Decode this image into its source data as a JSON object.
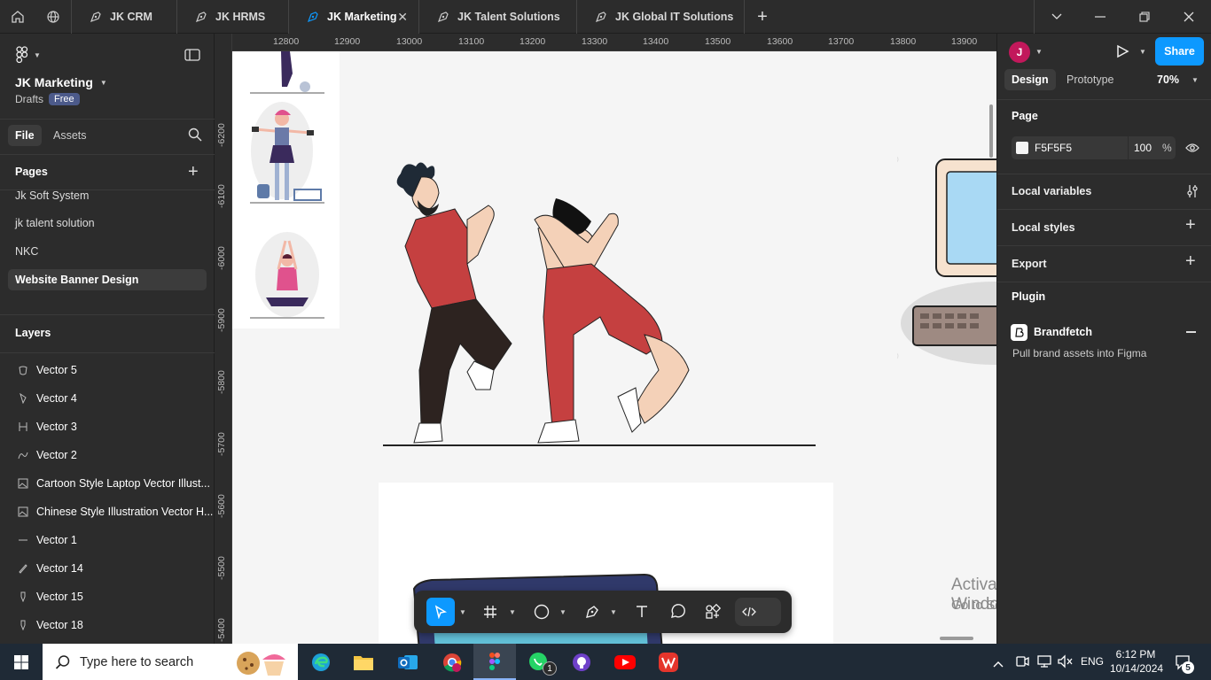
{
  "tabs": [
    {
      "label": "JK CRM"
    },
    {
      "label": "JK HRMS"
    },
    {
      "label": "JK Marketing",
      "active": true
    },
    {
      "label": "JK Talent Solutions"
    },
    {
      "label": "JK Global IT Solutions"
    }
  ],
  "left": {
    "file_name": "JK Marketing",
    "drafts": "Drafts",
    "plan": "Free",
    "tab_file": "File",
    "tab_assets": "Assets",
    "pages_title": "Pages",
    "pages": [
      "Jk Soft System",
      "jk talent solution",
      "NKC",
      "Website Banner Design"
    ],
    "layers_title": "Layers",
    "layers": [
      {
        "name": "Vector 5",
        "icon": "pen-vector-icon"
      },
      {
        "name": "Vector 4",
        "icon": "pen-vector-icon"
      },
      {
        "name": "Vector 3",
        "icon": "path-icon"
      },
      {
        "name": "Vector 2",
        "icon": "pen-vector-icon"
      },
      {
        "name": "Cartoon Style Laptop Vector Illust...",
        "icon": "image-icon"
      },
      {
        "name": "Chinese Style Illustration Vector H...",
        "icon": "image-icon"
      },
      {
        "name": "Vector 1",
        "icon": "line-icon"
      },
      {
        "name": "Vector 14",
        "icon": "pencil-icon"
      },
      {
        "name": "Vector 15",
        "icon": "pen-vector-icon"
      },
      {
        "name": "Vector 18",
        "icon": "pen-vector-icon"
      }
    ]
  },
  "ruler": {
    "top": [
      "12800",
      "12900",
      "13000",
      "13100",
      "13200",
      "13300",
      "13400",
      "13500",
      "13600",
      "13700",
      "13800",
      "13900"
    ],
    "left": [
      "-6200",
      "-6100",
      "-6000",
      "-5900",
      "-5800",
      "-5700",
      "-5600",
      "-5500",
      "-5400"
    ]
  },
  "right": {
    "avatar": "J",
    "share": "Share",
    "tab_design": "Design",
    "tab_prototype": "Prototype",
    "zoom": "70%",
    "page_title": "Page",
    "bg_hex": "F5F5F5",
    "bg_opacity": "100",
    "percent": "%",
    "local_variables": "Local variables",
    "local_styles": "Local styles",
    "export": "Export",
    "plugin_title": "Plugin",
    "plugin_name": "Brandfetch",
    "plugin_desc": "Pull brand assets into Figma"
  },
  "watermark": {
    "title": "Activate Windows",
    "sub": "Go to Settings to activate Windows."
  },
  "help": "?",
  "taskbar": {
    "search_placeholder": "Type here to search",
    "lang": "ENG",
    "time": "6:12 PM",
    "date": "10/14/2024",
    "notif": "5",
    "whatsapp_badge": "1"
  },
  "colors": {
    "accent": "#0d99ff",
    "panel": "#2c2c2c",
    "canvas": "#f5f5f5"
  }
}
